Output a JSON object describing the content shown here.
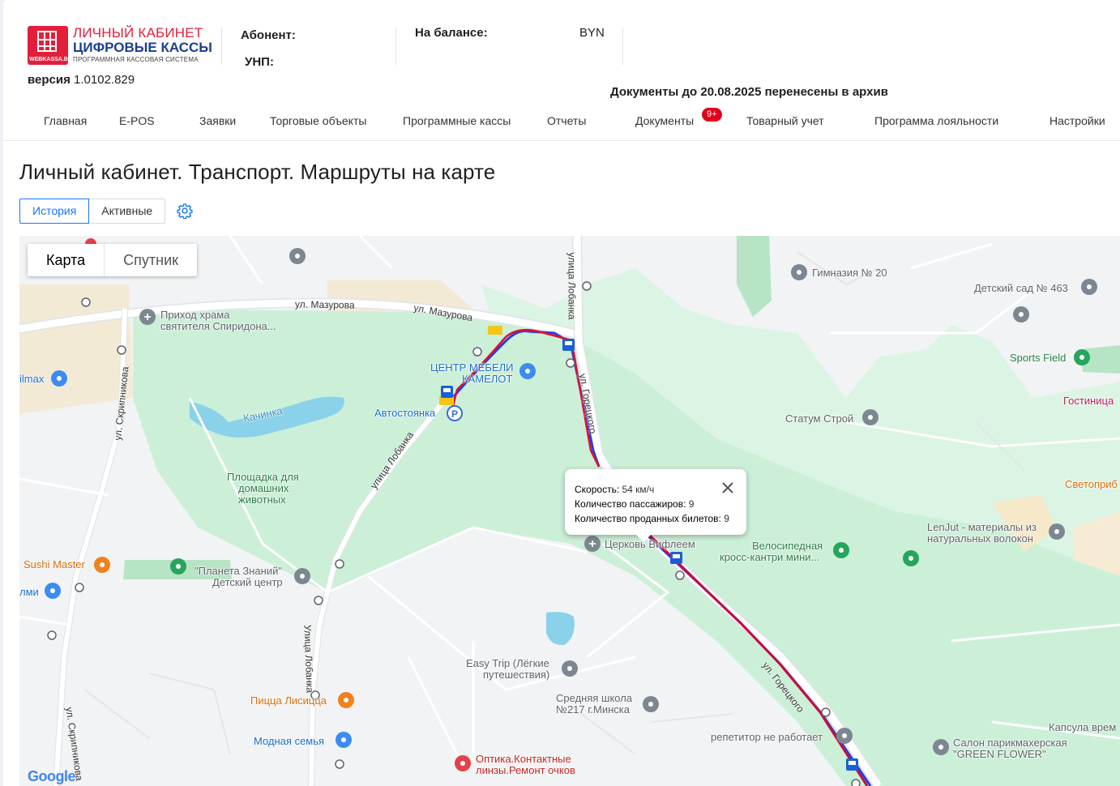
{
  "header": {
    "logo": {
      "line1": "ЛИЧНЫЙ КАБИНЕТ",
      "line2": "ЦИФРОВЫЕ КАССЫ",
      "line3": "ПРОГРАММНАЯ КАССОВАЯ СИСТЕМА",
      "badge": "WEBKASSA.BY"
    },
    "version_label": "версия",
    "version_value": "1.0102.829",
    "subscriber_label": "Абонент:",
    "unp_label": "УНП:",
    "balance_label": "На балансе:",
    "currency": "BYN",
    "archive_notice": "Документы до 20.08.2025 перенесены в архив"
  },
  "nav": {
    "items": [
      "Главная",
      "E-POS",
      "Заявки",
      "Торговые объекты",
      "Программные кассы",
      "Отчеты",
      "Документы",
      "Товарный учет",
      "Программа лояльности",
      "Настройки"
    ],
    "documents_badge": "9+"
  },
  "page": {
    "title": "Личный кабинет. Транспорт. Маршруты на карте",
    "tabs": [
      "История",
      "Активные"
    ],
    "active_tab": "История"
  },
  "map": {
    "type_buttons": [
      "Карта",
      "Спутник"
    ],
    "selected_type": "Карта",
    "info": {
      "speed_label": "Скорость:",
      "speed_value": "54 км/ч",
      "passengers_label": "Количество пассажиров:",
      "passengers_value": "9",
      "tickets_label": "Количество проданных билетов:",
      "tickets_value": "9"
    },
    "streets": [
      "ул. Мазурова",
      "ул. Мазурова",
      "улица Лобанка",
      "ул. Скрипникова",
      "улица Лобанка",
      "Улица Лобанка",
      "ул. Горецкого",
      "ул. Скрипникова",
      "ул. Горецкого"
    ],
    "places": {
      "p1": "Гимназия № 20",
      "p2": "Детский сад № 463",
      "p3": "Sports Field",
      "p4": "Гостиница",
      "p5": "Приход храма",
      "p5b": "святителя Спиридона...",
      "p6": "ilmax",
      "p7": "ЦЕНТР МЕБЕЛИ",
      "p7b": "КАМЕЛОТ",
      "p8": "Автостоянка",
      "p9": "Качинка",
      "p10": "Статум Строй",
      "p11": "Площадка для",
      "p11b": "домашних",
      "p11c": "животных",
      "p12": "Светоприб",
      "p13": "LenJut - материалы из",
      "p13b": "натуральных волокон",
      "p14": "Церковь Вифлеем",
      "p15": "Велосипедная",
      "p15b": "кросс-кантри мини...",
      "p16": "Sushi Master",
      "p17": "\"Планета Знаний\"",
      "p17b": "Детский центр",
      "p18": "лми",
      "p19": "Easy Trip (Лёгкие",
      "p19b": "путешествия)",
      "p20": "Средняя школа",
      "p20b": "№217 г.Минска",
      "p21": "Пицца Лисицца",
      "p22": "Модная семья",
      "p23": "репетитор не работает",
      "p24": "Капсула врем",
      "p25": "Салон парикмахерская",
      "p25b": "\"GREEN FLOWER\"",
      "p26": "Оптика.Контактные",
      "p26b": "линзы.Ремонт очков"
    },
    "attribution": "Google",
    "colors": {
      "route_red": "#e0102f",
      "route_blue": "#2b3be0",
      "park": "#c9f0d6",
      "road": "#ffffff"
    }
  }
}
